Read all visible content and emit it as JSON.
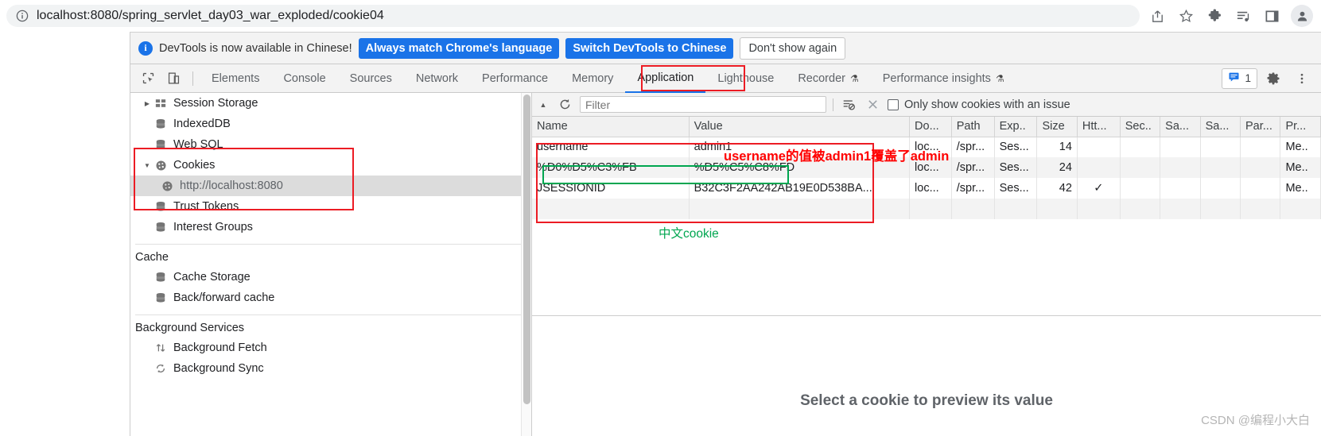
{
  "browser": {
    "url": "localhost:8080/spring_servlet_day03_war_exploded/cookie04",
    "url_host": "localhost:8080",
    "icons": {
      "site_info": "info-icon",
      "share": "share-icon",
      "bookmark": "star-icon",
      "extensions": "puzzle-icon",
      "reading_list": "reading-list-icon",
      "side_panel": "side-panel-icon",
      "profile": "profile-avatar-icon"
    }
  },
  "infobar": {
    "icon": "info-circle-icon",
    "message": "DevTools is now available in Chinese!",
    "primary_button": "Always match Chrome's language",
    "secondary_button": "Switch DevTools to Chinese",
    "dismiss_button": "Don't show again"
  },
  "tabstrip": {
    "inspect_icon": "inspect-element-icon",
    "device_toolbar_icon": "device-toolbar-icon",
    "tabs": [
      {
        "label": "Elements",
        "active": false,
        "experimental": false
      },
      {
        "label": "Console",
        "active": false,
        "experimental": false
      },
      {
        "label": "Sources",
        "active": false,
        "experimental": false
      },
      {
        "label": "Network",
        "active": false,
        "experimental": false
      },
      {
        "label": "Performance",
        "active": false,
        "experimental": false
      },
      {
        "label": "Memory",
        "active": false,
        "experimental": false
      },
      {
        "label": "Application",
        "active": true,
        "experimental": false
      },
      {
        "label": "Lighthouse",
        "active": false,
        "experimental": false
      },
      {
        "label": "Recorder",
        "active": false,
        "experimental": true
      },
      {
        "label": "Performance insights",
        "active": false,
        "experimental": true
      }
    ],
    "issues_count": "1",
    "issues_icon": "issues-message-icon",
    "settings_icon": "gear-icon",
    "more_icon": "kebab-menu-icon"
  },
  "sidebar": {
    "storage_items": [
      {
        "label": "Session Storage",
        "icon": "table-icon",
        "twisty": "▶",
        "indent": 0,
        "selected": false
      },
      {
        "label": "IndexedDB",
        "icon": "database-icon",
        "twisty": "",
        "indent": 0,
        "selected": false
      },
      {
        "label": "Web SQL",
        "icon": "database-icon",
        "twisty": "",
        "indent": 0,
        "selected": false
      },
      {
        "label": "Cookies",
        "icon": "cookie-icon",
        "twisty": "▼",
        "indent": 0,
        "selected": false
      },
      {
        "label": "http://localhost:8080",
        "icon": "cookie-icon",
        "twisty": "",
        "indent": 1,
        "selected": true
      },
      {
        "label": "Trust Tokens",
        "icon": "database-icon",
        "twisty": "",
        "indent": 0,
        "selected": false
      },
      {
        "label": "Interest Groups",
        "icon": "database-icon",
        "twisty": "",
        "indent": 0,
        "selected": false
      }
    ],
    "cache_title": "Cache",
    "cache_items": [
      {
        "label": "Cache Storage",
        "icon": "database-icon"
      },
      {
        "label": "Back/forward cache",
        "icon": "database-icon"
      }
    ],
    "background_title": "Background Services",
    "background_items": [
      {
        "label": "Background Fetch",
        "icon": "updown-arrows-icon"
      },
      {
        "label": "Background Sync",
        "icon": "sync-icon"
      }
    ]
  },
  "cookies": {
    "toolbar": {
      "scroll_up_icon": "chevron-up-icon",
      "refresh_icon": "refresh-icon",
      "filter_placeholder": "Filter",
      "filter_value": "",
      "clear_all_icon": "clear-all-cookies-icon",
      "delete_icon": "delete-icon",
      "issue_checkbox_label": "Only show cookies with an issue",
      "issue_checkbox_checked": false
    },
    "columns": [
      "Name",
      "Value",
      "Do...",
      "Path",
      "Exp..",
      "Size",
      "Htt...",
      "Sec..",
      "Sa...",
      "Sa...",
      "Par...",
      "Pr..."
    ],
    "rows": [
      {
        "name": "username",
        "value": "admin1",
        "domain": "loc...",
        "path": "/spr...",
        "expires": "Ses...",
        "size": "14",
        "httponly": "",
        "secure": "",
        "samesite": "",
        "samepartykey": "",
        "partition": "",
        "priority": "Me.."
      },
      {
        "name": "%D0%D5%C3%FB",
        "value": "%D5%C5%C8%FD",
        "domain": "loc...",
        "path": "/spr...",
        "expires": "Ses...",
        "size": "24",
        "httponly": "",
        "secure": "",
        "samesite": "",
        "samepartykey": "",
        "partition": "",
        "priority": "Me.."
      },
      {
        "name": "JSESSIONID",
        "value": "B32C3F2AA242AB19E0D538BA...",
        "domain": "loc...",
        "path": "/spr...",
        "expires": "Ses...",
        "size": "42",
        "httponly": "✓",
        "secure": "",
        "samesite": "",
        "samepartykey": "",
        "partition": "",
        "priority": "Me.."
      }
    ],
    "preview_message": "Select a cookie to preview its value"
  },
  "annotations": {
    "red_note": "username的值被admin1覆盖了admin",
    "green_note": "中文cookie"
  },
  "watermark": "CSDN @编程小大白",
  "colors": {
    "accent_blue": "#1a73e8",
    "annotation_red": "#ff0000",
    "annotation_green": "#00a650",
    "selected_row": "#dcdcdc"
  }
}
